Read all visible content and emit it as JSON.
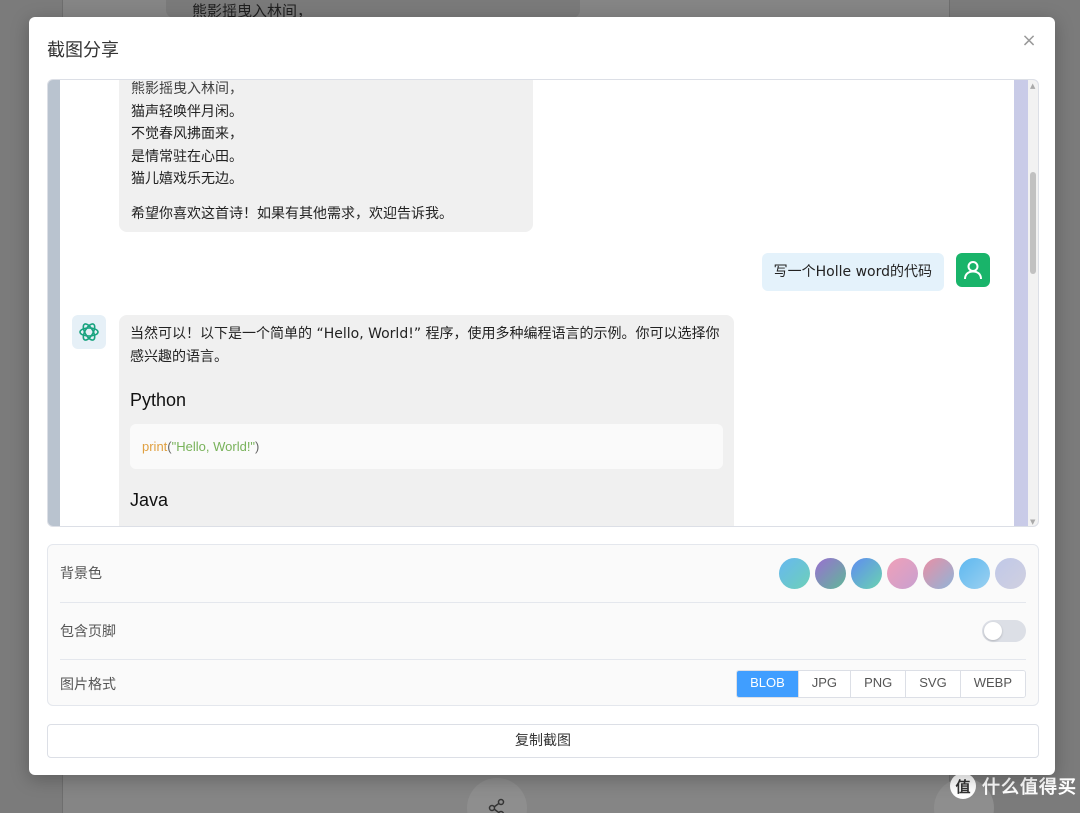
{
  "background": {
    "bubble_text": "熊影摇曳入林间，",
    "watermark_logo": "值",
    "watermark_text": "什么值得买"
  },
  "modal": {
    "title": "截图分享",
    "close_icon": "×"
  },
  "preview": {
    "prev_bubble": {
      "lines": [
        "熊影摇曳入林间，",
        "猫声轻唤伴月闲。",
        "不觉春风拂面来，",
        "是情常驻在心田。",
        "猫儿嬉戏乐无边。"
      ],
      "closing": "希望你喜欢这首诗！如果有其他需求，欢迎告诉我。"
    },
    "user_message": "写一个Holle word的代码",
    "bot_message": {
      "intro": "当然可以！以下是一个简单的 “Hello, World!” 程序，使用多种编程语言的示例。你可以选择你感兴趣的语言。",
      "heading_python": "Python",
      "code_fn": "print",
      "code_open": "(",
      "code_str": "\"Hello, World!\"",
      "code_close": ")",
      "heading_java": "Java"
    }
  },
  "settings": {
    "bg_label": "背景色",
    "footer_label": "包含页脚",
    "format_label": "图片格式",
    "swatches": [
      "linear-gradient(135deg,#67b8f0,#6dd0b8)",
      "linear-gradient(135deg,#9a6fd1,#5fb898)",
      "linear-gradient(135deg,#5f8cf0,#6ad3b0)",
      "linear-gradient(135deg,#f0a0b8,#c8a0d0)",
      "linear-gradient(135deg,#e98fa5,#8fb4d8)",
      "linear-gradient(135deg,#5eb8f0,#9ad0f0)",
      "linear-gradient(135deg,#c0c8e8,#d0d0e0)"
    ],
    "formats": [
      "BLOB",
      "JPG",
      "PNG",
      "SVG",
      "WEBP"
    ],
    "active_format": "BLOB",
    "footer_enabled": false
  },
  "copy_button": "复制截图"
}
